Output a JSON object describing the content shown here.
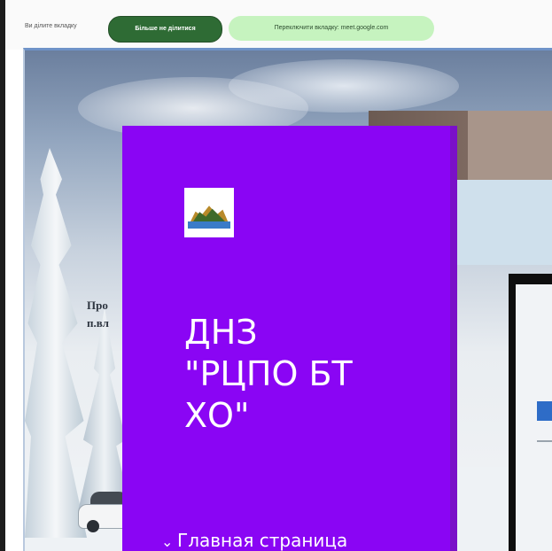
{
  "share_bar": {
    "presenting_text": "Ви ділите вкладку",
    "stop_button_label": "Більше не ділитися",
    "switch_button_label": "Переключити вкладку: meet.google.com"
  },
  "background_page": {
    "pamphlet_text_line1": "Про",
    "pamphlet_text_line2": "п.вл"
  },
  "panel": {
    "background_color": "#8a05f4",
    "logo_icon": "school-logo-icon",
    "title": "ДНЗ\n\"РЦПО БТ\nХО\"",
    "nav": [
      {
        "label": "Главная страница",
        "icon": "chevron-down-icon"
      }
    ]
  }
}
